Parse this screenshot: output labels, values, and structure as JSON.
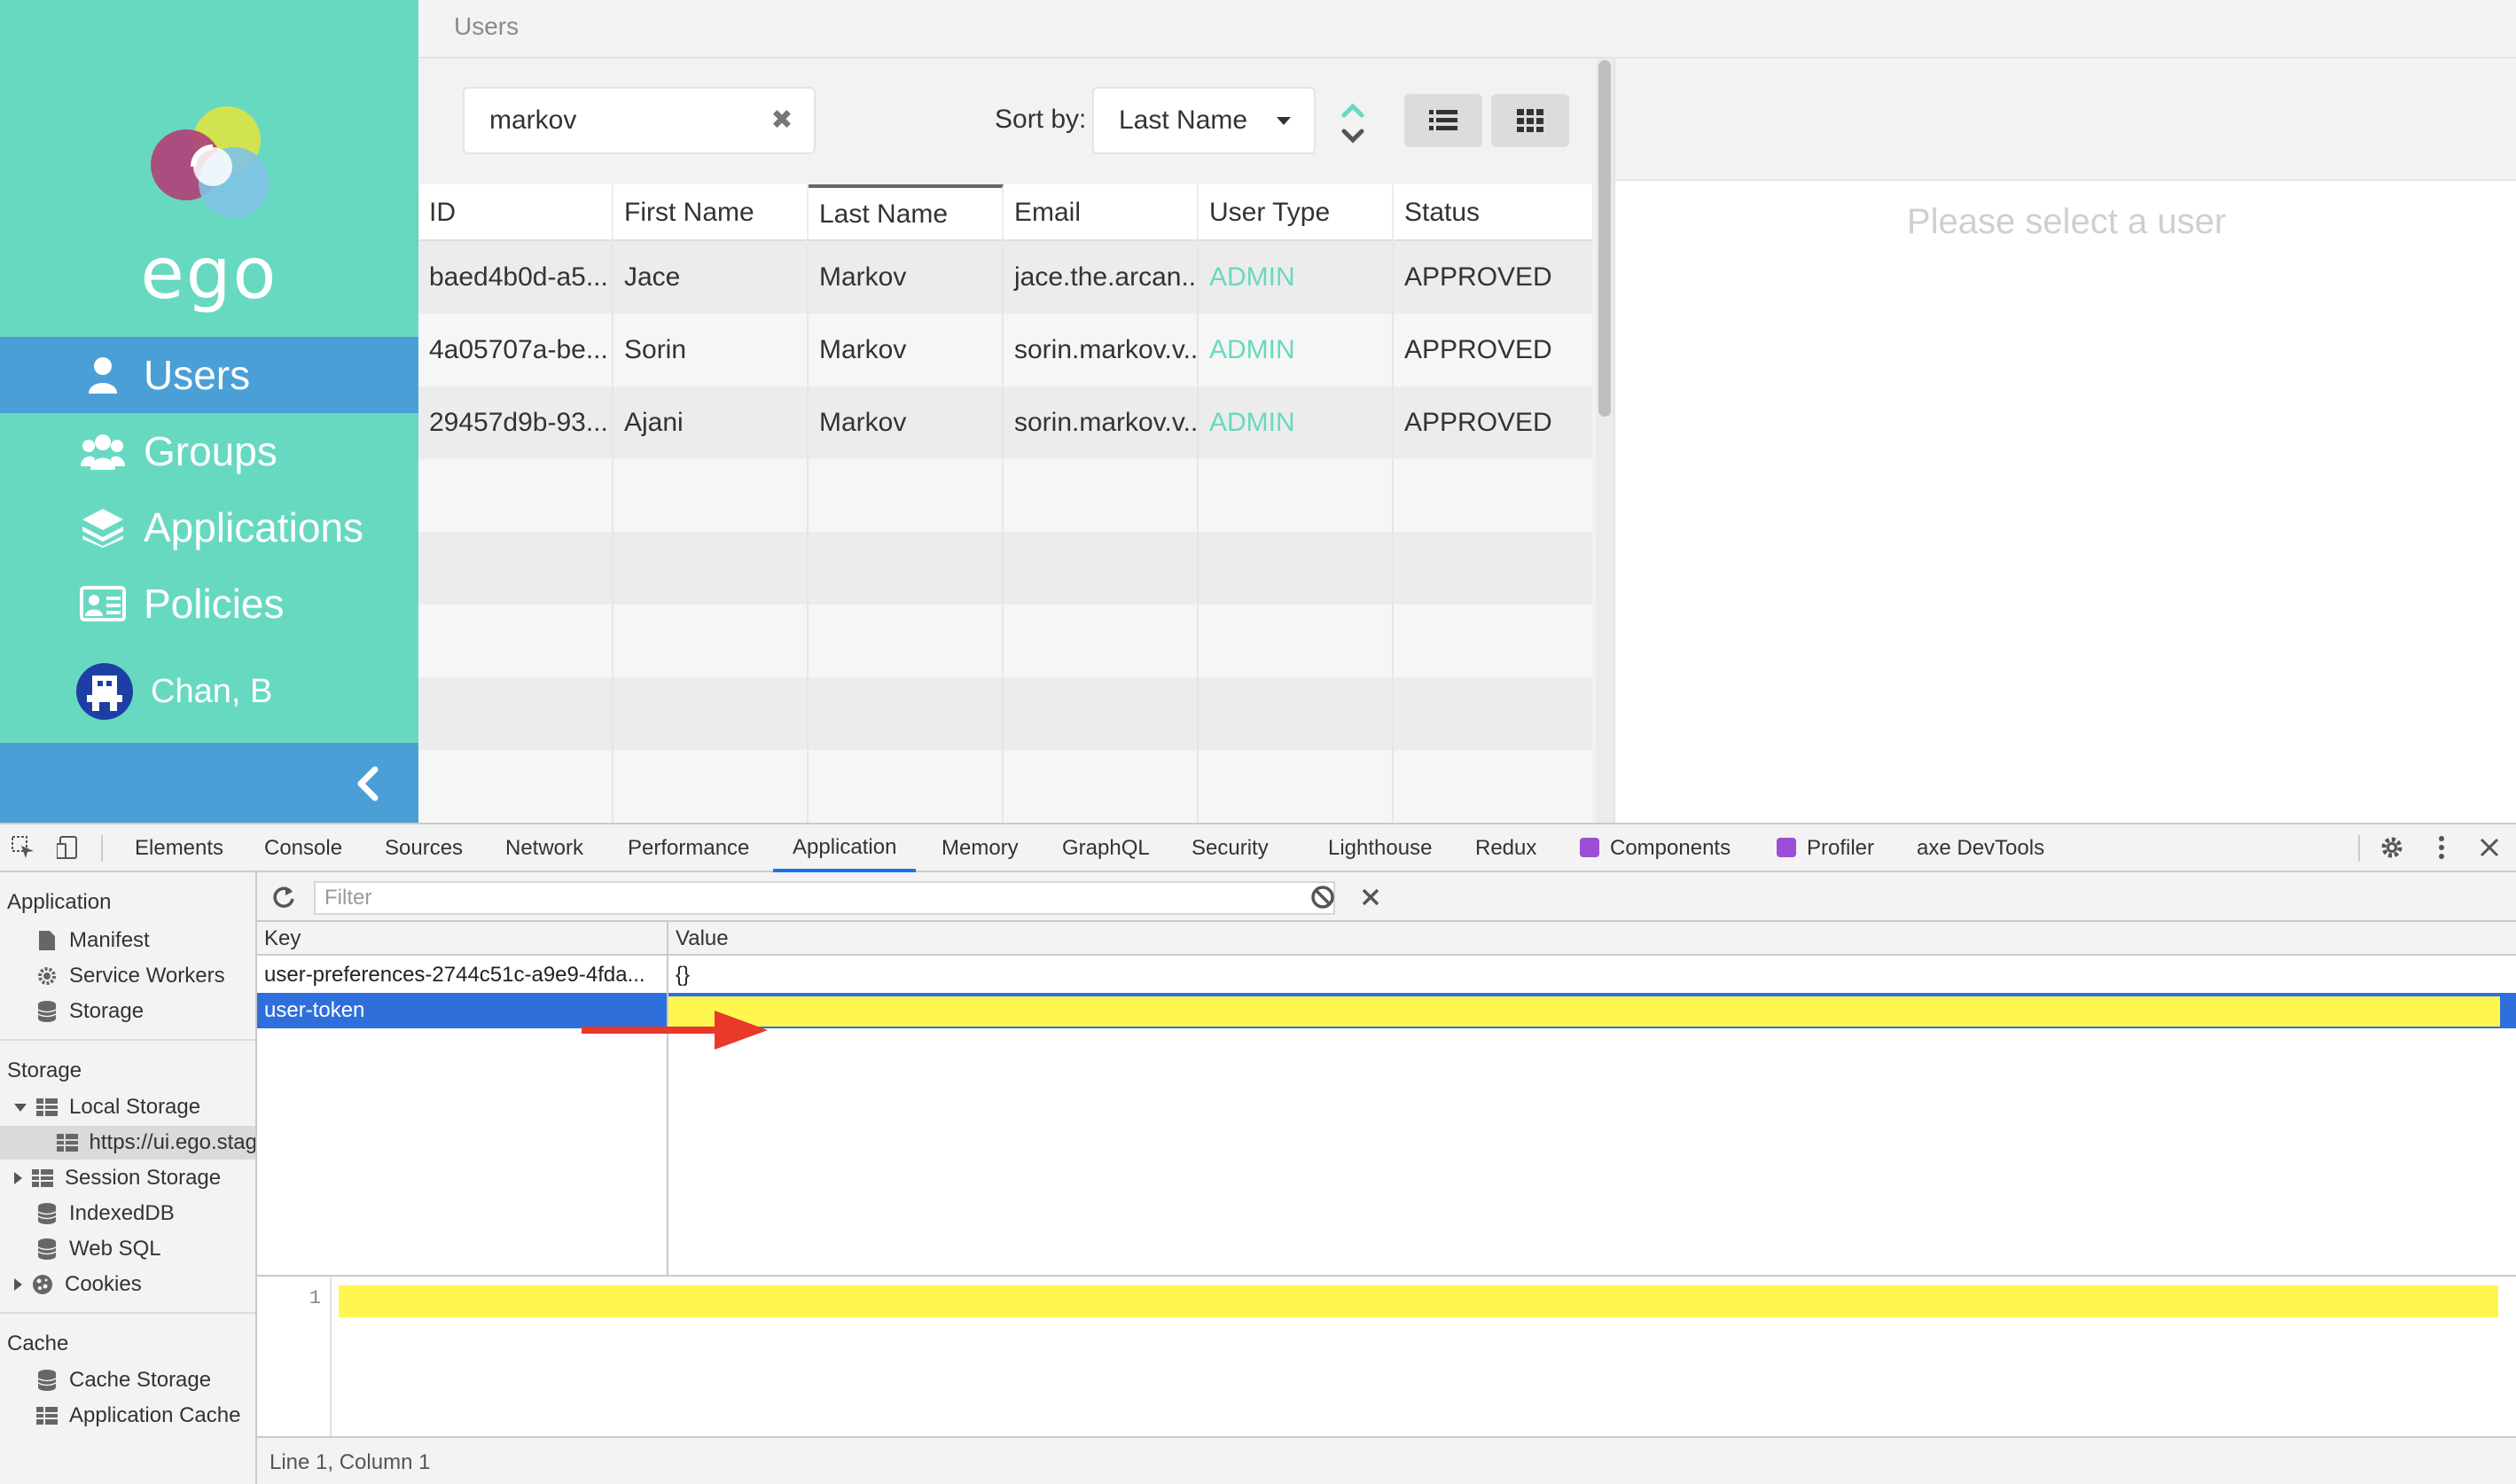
{
  "app": {
    "logo_text": "ego",
    "header_title": "Users",
    "nav": [
      {
        "label": "Users",
        "icon": "user-icon",
        "active": true
      },
      {
        "label": "Groups",
        "icon": "group-icon"
      },
      {
        "label": "Applications",
        "icon": "layers-icon"
      },
      {
        "label": "Policies",
        "icon": "policy-icon"
      }
    ],
    "current_user": "Chan, B",
    "colors": {
      "sidebar": "#67d9c0",
      "active_nav": "#4a9fd6",
      "admin_text": "#67d9c0"
    }
  },
  "list": {
    "search_value": "markov",
    "sort_label": "Sort by:",
    "sort_value": "Last Name",
    "columns": [
      "ID",
      "First Name",
      "Last Name",
      "Email",
      "User Type",
      "Status"
    ],
    "rows": [
      {
        "id": "baed4b0d-a5...",
        "first": "Jace",
        "last": "Markov",
        "email": "jace.the.arcan...",
        "type": "ADMIN",
        "status": "APPROVED"
      },
      {
        "id": "4a05707a-be...",
        "first": "Sorin",
        "last": "Markov",
        "email": "sorin.markov.v...",
        "type": "ADMIN",
        "status": "APPROVED"
      },
      {
        "id": "29457d9b-93...",
        "first": "Ajani",
        "last": "Markov",
        "email": "sorin.markov.v...",
        "type": "ADMIN",
        "status": "APPROVED"
      }
    ]
  },
  "detail": {
    "empty_message": "Please select a user"
  },
  "devtools": {
    "tabs": [
      "Elements",
      "Console",
      "Sources",
      "Network",
      "Performance",
      "Application",
      "Memory",
      "GraphQL",
      "Security",
      "Lighthouse",
      "Redux",
      "Components",
      "Profiler",
      "axe DevTools"
    ],
    "active_tab": "Application",
    "sidebar": {
      "application_heading": "Application",
      "manifest": "Manifest",
      "service_workers": "Service Workers",
      "storage_item": "Storage",
      "storage_heading": "Storage",
      "local_storage": "Local Storage",
      "local_storage_origin": "https://ui.ego.stag",
      "session_storage": "Session Storage",
      "indexeddb": "IndexedDB",
      "web_sql": "Web SQL",
      "cookies": "Cookies",
      "cache_heading": "Cache",
      "cache_storage": "Cache Storage",
      "application_cache": "Application Cache"
    },
    "filter_placeholder": "Filter",
    "kv_headers": {
      "key": "Key",
      "value": "Value"
    },
    "kv_rows": [
      {
        "key": "user-preferences-2744c51c-a9e9-4fda...",
        "value": "{}"
      },
      {
        "key": "user-token",
        "value": ""
      }
    ],
    "editor_line_number": "1",
    "status": "Line 1, Column 1",
    "highlight_color": "#fff750",
    "arrow_color": "#e8392a"
  }
}
